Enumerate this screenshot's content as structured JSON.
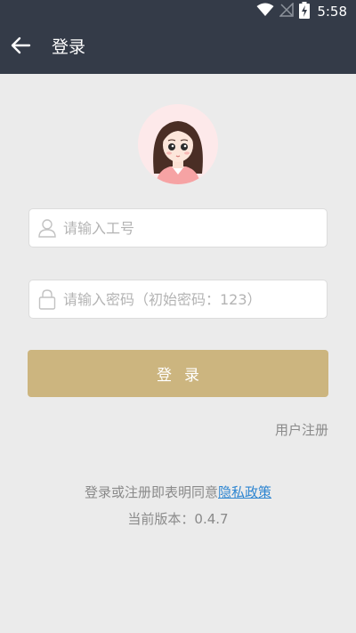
{
  "status_bar": {
    "time": "5:58",
    "icons": [
      "wifi-icon",
      "no-signal-icon",
      "battery-charging-icon"
    ]
  },
  "title_bar": {
    "back_icon": "arrow-left-icon",
    "title": "登录"
  },
  "avatar": {
    "icon": "girl-avatar-icon"
  },
  "form": {
    "employee_id": {
      "icon": "user-icon",
      "value": "",
      "placeholder": "请输入工号"
    },
    "password": {
      "icon": "lock-icon",
      "value": "",
      "placeholder": "请输入密码（初始密码：123）"
    },
    "login_label": "登录",
    "register_label": "用户注册"
  },
  "footer": {
    "agreement_prefix": "登录或注册即表明同意",
    "privacy_label": "隐私政策",
    "version_text": "当前版本：0.4.7"
  },
  "colors": {
    "header_bg": "#343b48",
    "page_bg": "#ebebeb",
    "accent": "#ccb57f",
    "link": "#2f86d1"
  }
}
